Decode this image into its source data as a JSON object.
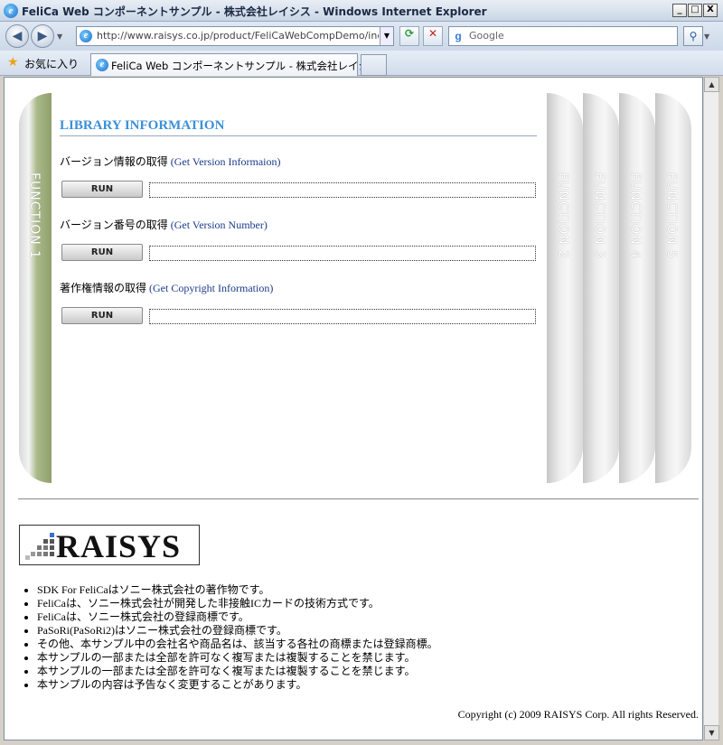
{
  "window": {
    "title": "FeliCa Web コンポーネントサンプル - 株式会社レイシス - Windows Internet Explorer",
    "controls": {
      "minimize": "_",
      "maximize": "□",
      "close": "X"
    }
  },
  "navbar": {
    "back": "◀",
    "forward": "▶",
    "url": "http://www.raisys.co.jp/product/FeliCaWebCompDemo/index",
    "search_placeholder": "Google"
  },
  "favorites": {
    "label": "お気に入り"
  },
  "tabs": [
    {
      "label": "FeliCa Web コンポーネントサンプル - 株式会社レイシス"
    }
  ],
  "page": {
    "section_title": "LIBRARY INFORMATION",
    "functions": [
      {
        "label": "FUNCTION 1"
      },
      {
        "label": "FUNCTION 2"
      },
      {
        "label": "FUNCTION 3"
      },
      {
        "label": "FUNCTION 4"
      },
      {
        "label": "FUNCTION 5"
      }
    ],
    "rows": [
      {
        "label_ja": "バージョン情報の取得",
        "label_en": "(Get Version Informaion)",
        "button": "RUN",
        "result": ""
      },
      {
        "label_ja": "バージョン番号の取得",
        "label_en": "(Get Version Number)",
        "button": "RUN",
        "result": ""
      },
      {
        "label_ja": "著作権情報の取得",
        "label_en": "(Get Copyright Information)",
        "button": "RUN",
        "result": ""
      }
    ],
    "logo_text": "RAISYS",
    "notes": [
      "SDK For FeliCaはソニー株式会社の著作物です。",
      "FeliCaは、ソニー株式会社が開発した非接触ICカードの技術方式です。",
      "FeliCaは、ソニー株式会社の登録商標です。",
      "PaSoRi(PaSoRi2)はソニー株式会社の登録商標です。",
      "その他、本サンプル中の会社名や商品名は、該当する各社の商標または登録商標。",
      "本サンプルの一部または全部を許可なく複写または複製することを禁じます。",
      "本サンプルの一部または全部を許可なく複写または複製することを禁じます。",
      "本サンプルの内容は予告なく変更することがあります。"
    ],
    "copyright": "Copyright (c) 2009 RAISYS Corp. All rights Reserved."
  },
  "colors": {
    "accent": "#3b90d8",
    "active_panel": "#8fa06c",
    "link": "#1a3a8a"
  }
}
